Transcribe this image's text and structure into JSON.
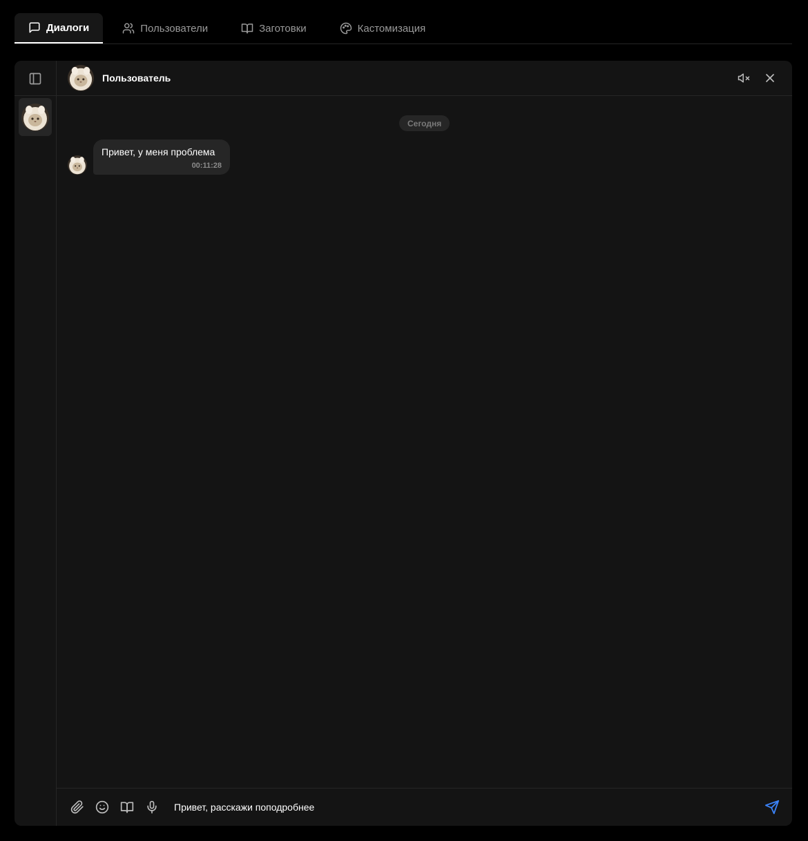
{
  "tabs": [
    {
      "label": "Диалоги",
      "icon": "chat-bubble-icon",
      "active": true
    },
    {
      "label": "Пользователи",
      "icon": "users-icon",
      "active": false
    },
    {
      "label": "Заготовки",
      "icon": "book-icon",
      "active": false
    },
    {
      "label": "Кастомизация",
      "icon": "palette-icon",
      "active": false
    }
  ],
  "chat": {
    "contact_name": "Пользователь",
    "date_separator": "Сегодня",
    "messages": [
      {
        "text": "Привет, у меня проблема",
        "time": "00:11:28",
        "direction": "incoming"
      }
    ]
  },
  "composer": {
    "value": "Привет, расскажи поподробнее"
  },
  "colors": {
    "background": "#000000",
    "panel": "#141414",
    "bubble": "#262626",
    "send_accent": "#3b82f6"
  }
}
